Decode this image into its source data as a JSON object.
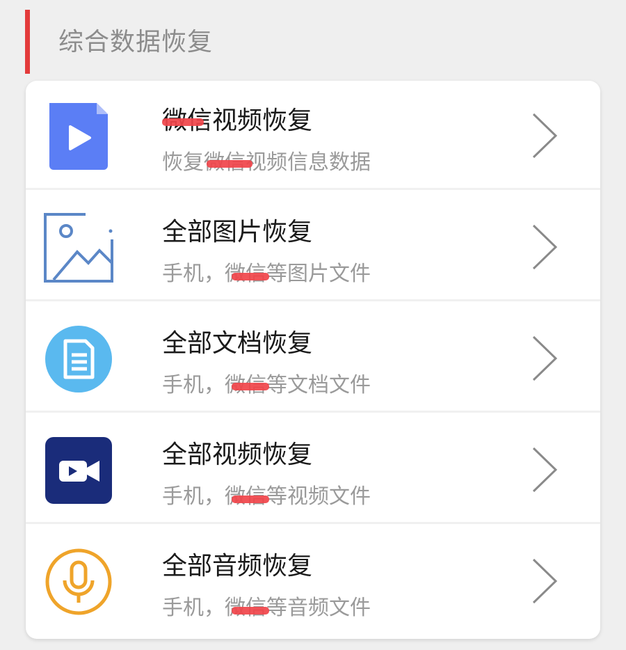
{
  "section": {
    "title": "综合数据恢复",
    "accent_color": "#e33b3b"
  },
  "items": [
    {
      "title": "微信视频恢复",
      "subtitle": "恢复微信视频信息数据",
      "icon": "video-file-icon",
      "icon_color": "#5b7ef5"
    },
    {
      "title": "全部图片恢复",
      "subtitle": "手机，微信等图片文件",
      "icon": "image-icon",
      "icon_color": "#5b87c7"
    },
    {
      "title": "全部文档恢复",
      "subtitle": "手机，微信等文档文件",
      "icon": "document-icon",
      "icon_color": "#5ab9ef"
    },
    {
      "title": "全部视频恢复",
      "subtitle": "手机，微信等视频文件",
      "icon": "video-camera-icon",
      "icon_color": "#1a2c7a"
    },
    {
      "title": "全部音频恢复",
      "subtitle": "手机，微信等音频文件",
      "icon": "microphone-icon",
      "icon_color": "#efa42a"
    }
  ]
}
